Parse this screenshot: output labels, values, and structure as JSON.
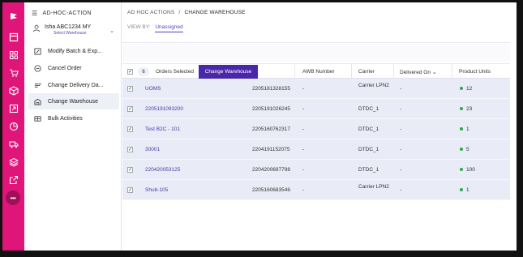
{
  "sidebar": {
    "title": "AD-HOC-ACTION",
    "user_name": "Isha ABC1234 MY",
    "user_sub": "Select Warehouse",
    "items": [
      {
        "label": "Modify Batch & Exp...",
        "icon": "edit-icon"
      },
      {
        "label": "Cancel Order",
        "icon": "cancel-icon"
      },
      {
        "label": "Change Delivery Da...",
        "icon": "delivery-icon"
      },
      {
        "label": "Change Warehouse",
        "icon": "warehouse-icon",
        "active": true
      },
      {
        "label": "Bulk Activities",
        "icon": "bulk-icon"
      }
    ]
  },
  "rail": {
    "icons": [
      "logo-icon",
      "dashboard-icon",
      "grid-icon",
      "orders-icon",
      "box-icon",
      "returns-icon",
      "chart-icon",
      "truck-icon",
      "layers-icon",
      "export-icon",
      "more-icon"
    ],
    "more_label": "•••"
  },
  "header": {
    "crumb_root": "AD HOC ACTIONS",
    "crumb_sep": "/",
    "crumb_current": "CHANGE WAREHOUSE",
    "view_by_label": "VIEW BY:",
    "view_by_option": "Unassigned"
  },
  "table": {
    "selected_count": "6",
    "selected_label": "Orders Selected",
    "action_button": "Change Warehouse",
    "columns": {
      "awb": "AWB Number",
      "carrier": "Carrier",
      "delivered": "Delivered On",
      "units": "Product Units"
    },
    "rows": [
      {
        "order": "UOMS",
        "id": "2205181328155",
        "awb": "-",
        "carrier": "Carrier LPN2",
        "delivered": "-",
        "units": "12"
      },
      {
        "order": "2205191093200",
        "id": "2205191026245",
        "awb": "-",
        "carrier": "DTDC_1",
        "delivered": "-",
        "units": "23"
      },
      {
        "order": "Test B2C - 101",
        "id": "2205160762317",
        "awb": "-",
        "carrier": "DTDC_1",
        "delivered": "-",
        "units": "1"
      },
      {
        "order": "30001",
        "id": "2204191152075",
        "awb": "-",
        "carrier": "DTDC_1",
        "delivered": "-",
        "units": "5"
      },
      {
        "order": "220420053125",
        "id": "2204200697798",
        "awb": "-",
        "carrier": "DTDC_1",
        "delivered": "-",
        "units": "100"
      },
      {
        "order": "Shub-105",
        "id": "2205160683546",
        "awb": "-",
        "carrier": "Carrier LPN2",
        "delivered": "-",
        "units": "1"
      }
    ]
  },
  "colors": {
    "rail": "#e0157a",
    "accent": "#4a27a8",
    "row_bg": "#e9ebf6",
    "status_dot": "#2eaa4a"
  }
}
